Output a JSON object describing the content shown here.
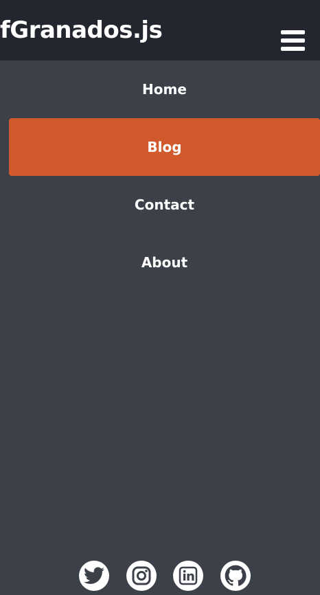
{
  "header": {
    "logo_text": "fGranados.js",
    "menu_icon": "hamburger-menu-icon"
  },
  "nav": {
    "items": [
      {
        "label": "Home",
        "active": false
      },
      {
        "label": "Blog",
        "active": true
      },
      {
        "label": "Contact",
        "active": false
      },
      {
        "label": "About",
        "active": false
      }
    ]
  },
  "social": {
    "icons": [
      "twitter-icon",
      "instagram-icon",
      "linkedin-icon",
      "github-icon"
    ]
  },
  "colors": {
    "header_bg": "#23262e",
    "page_bg": "#3c4049",
    "accent": "#d05a2c",
    "text": "#ffffff"
  }
}
